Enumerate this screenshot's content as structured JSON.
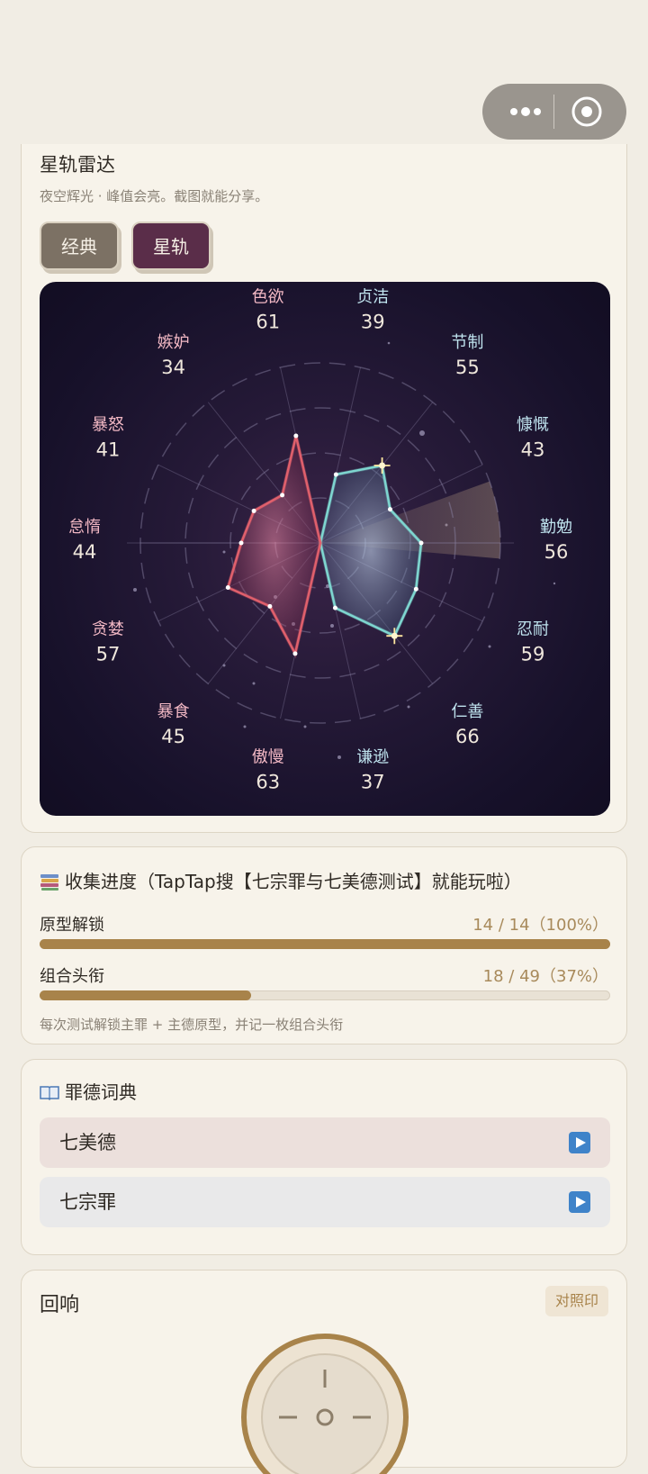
{
  "capsule": {
    "more_icon": "more-dots-icon",
    "close_icon": "target-circle-icon"
  },
  "radar_card": {
    "title": "星轨雷达",
    "subtitle": "夜空辉光 · 峰值会亮。截图就能分享。",
    "buttons": [
      {
        "label": "经典"
      },
      {
        "label": "星轨"
      }
    ],
    "selected_mode": "星轨"
  },
  "chart_data": {
    "type": "radar",
    "max": 100,
    "axes": [
      {
        "label": "贞洁",
        "value": 39
      },
      {
        "label": "节制",
        "value": 55
      },
      {
        "label": "慷慨",
        "value": 43
      },
      {
        "label": "勤勉",
        "value": 56
      },
      {
        "label": "忍耐",
        "value": 59
      },
      {
        "label": "仁善",
        "value": 66
      },
      {
        "label": "谦逊",
        "value": 37
      },
      {
        "label": "傲慢",
        "value": 63
      },
      {
        "label": "暴食",
        "value": 45
      },
      {
        "label": "贪婪",
        "value": 57
      },
      {
        "label": "怠惰",
        "value": 44
      },
      {
        "label": "暴怒",
        "value": 41
      },
      {
        "label": "嫉妒",
        "value": 34
      },
      {
        "label": "色欲",
        "value": 61
      }
    ],
    "series": [
      {
        "group": "virtues",
        "axes": [
          "贞洁",
          "节制",
          "慷慨",
          "勤勉",
          "忍耐",
          "仁善",
          "谦逊"
        ],
        "color": "#7ed6d0"
      },
      {
        "group": "sins",
        "axes": [
          "傲慢",
          "暴食",
          "贪婪",
          "怠惰",
          "暴怒",
          "嫉妒",
          "色欲"
        ],
        "color": "#e0606c"
      }
    ],
    "label_colors": {
      "virtues": "#bfe3ee",
      "sins": "#f2b8c4"
    }
  },
  "progress": {
    "icon": "books-icon",
    "title": "收集进度（TapTap搜【七宗罪与七美德测试】就能玩啦）",
    "items": [
      {
        "label": "原型解锁",
        "value_text": "14 / 14（100%）",
        "fraction": 1.0
      },
      {
        "label": "组合头衔",
        "value_text": "18 / 49（37%）",
        "fraction": 0.37
      }
    ],
    "note": "每次测试解锁主罪 + 主德原型，并记一枚组合头衔"
  },
  "dictionary": {
    "icon": "open-book-icon",
    "title": "罪德词典",
    "rows": [
      {
        "label": "七美德"
      },
      {
        "label": "七宗罪"
      }
    ]
  },
  "echo": {
    "title": "回响",
    "tag": "对照印"
  }
}
